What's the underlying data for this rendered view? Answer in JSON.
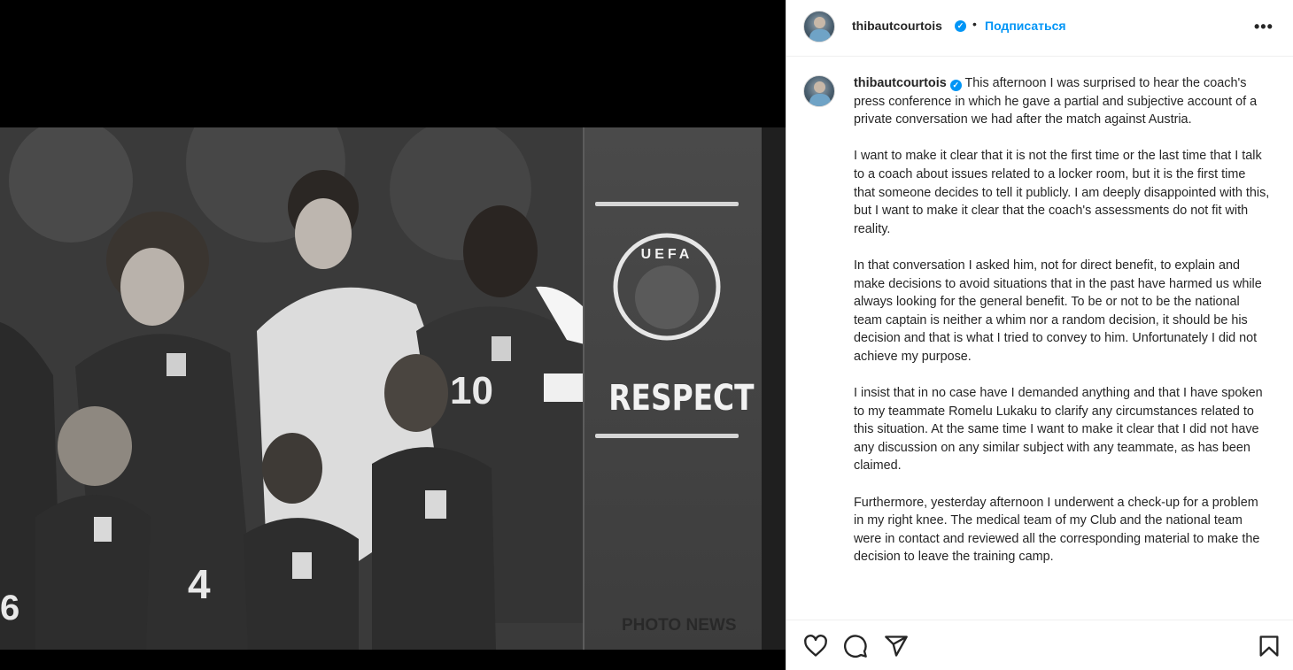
{
  "post": {
    "username": "thibautcourtois",
    "follow_label": "Подписаться",
    "header_separator": "•",
    "more_label": "•••"
  },
  "media": {
    "board_text": "RESPECT",
    "logo_text": "UEFA",
    "credit": "PHOTO NEWS",
    "jersey_numbers": [
      "10",
      "4",
      "6"
    ]
  },
  "caption": {
    "username": "thibautcourtois",
    "paragraph_1": "This afternoon I was surprised to hear the coach's press conference in which he gave a partial and subjective account of a private conversation we had after the match against Austria.",
    "paragraph_2": "I want to make it clear that it is not the first time or the last time that I talk to a coach about issues related to a locker room, but it is the first time that someone decides to tell it publicly. I am deeply disappointed with this, but I want to make it clear that the coach's assessments do not fit with reality.",
    "paragraph_3": "In that conversation I asked him, not for direct benefit, to explain and make decisions to avoid situations that in the past have harmed us while always looking for the general benefit. To be or not to be the national team captain is neither a whim nor a random decision, it should be his decision and that is what I tried to convey to him. Unfortunately I did not achieve my purpose.",
    "paragraph_4": "I insist that in no case have I demanded anything and that I have spoken to my teammate Romelu Lukaku to clarify any circumstances related to this situation. At the same time I want to make it clear that I did not have any discussion on any similar subject with any teammate, as has been claimed.",
    "paragraph_5": "Furthermore, yesterday afternoon I underwent a check-up for a problem in my right knee. The medical team of my Club and the national team were in contact and reviewed all the corresponding material to make the decision to leave the training camp."
  },
  "icons": {
    "like": "heart-icon",
    "comment": "comment-icon",
    "share": "paper-plane-icon",
    "save": "bookmark-icon",
    "verified": "verified-badge-icon",
    "more": "more-options-icon"
  },
  "colors": {
    "link": "#0095f6",
    "text": "#262626",
    "border": "#dbdbdb"
  }
}
